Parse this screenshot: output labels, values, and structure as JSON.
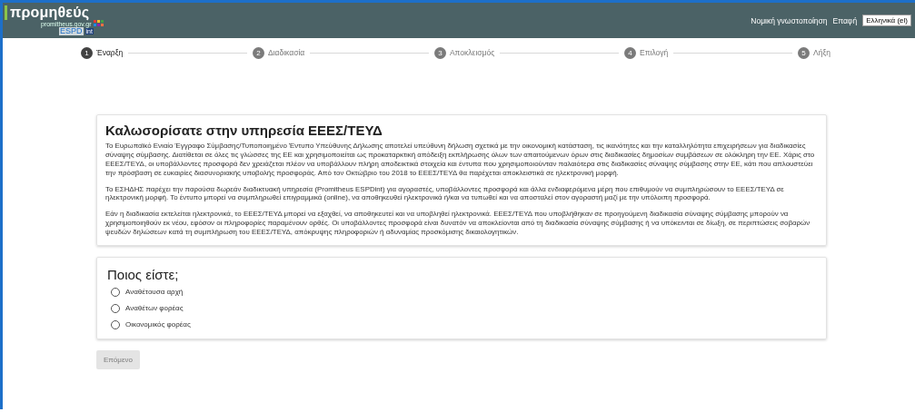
{
  "header": {
    "logo": {
      "name": "προμηθεύς",
      "domain": "promitheus.gov.gr",
      "product": "ESPD",
      "badge": "int"
    },
    "links": [
      {
        "label": "Νομική γνωστοποίηση"
      },
      {
        "label": "Επαφή"
      }
    ],
    "language": {
      "value": "Ελληνικά (el)"
    }
  },
  "steps": [
    {
      "number": "1",
      "label": "Έναρξη",
      "selected": true
    },
    {
      "number": "2",
      "label": "Διαδικασία",
      "selected": false
    },
    {
      "number": "3",
      "label": "Αποκλεισμός",
      "selected": false
    },
    {
      "number": "4",
      "label": "Επιλογή",
      "selected": false
    },
    {
      "number": "5",
      "label": "Λήξη",
      "selected": false
    }
  ],
  "welcome": {
    "title": "Καλωσορίσατε στην υπηρεσία ΕΕΕΣ/ΤΕΥΔ",
    "paragraphs": [
      "Το Ευρωπαϊκό Ενιαίο Έγγραφο Σύμβασης/Τυποποιημένο Έντυπο Υπεύθυνης Δήλωσης αποτελεί υπεύθυνη δήλωση σχετικά με την οικονομική κατάσταση, τις ικανότητες και την καταλληλότητα επιχειρήσεων για διαδικασίες σύναψης σύμβασης. Διατίθεται σε όλες τις γλώσσες της ΕΕ και χρησιμοποιείται ως προκαταρκτική απόδειξη εκπλήρωσης όλων των απαιτούμενων όρων στις διαδικασίες δημοσίων συμβάσεων σε ολόκληρη την ΕΕ. Χάρις στο ΕΕΕΣ/ΤΕΥΔ, οι υποβάλλοντες προσφορά δεν χρειάζεται πλέον να υποβάλλουν πλήρη αποδεικτικά στοιχεία και έντυπα που χρησιμοποιούνταν παλαιότερα στις διαδικασίες σύναψης σύμβασης στην ΕΕ, κάτι που απλουστεύει την πρόσβαση σε ευκαιρίες διασυνοριακής υποβολής προσφοράς. Από τον Οκτώβριο του 2018 το ΕΕΕΣ/ΤΕΥΔ θα παρέχεται αποκλειστικά σε ηλεκτρονική μορφή.",
      "Το ΕΣΗΔΗΣ παρέχει την παρούσα δωρεάν διαδικτυακή υπηρεσία (Promitheus ESPDint) για αγοραστές, υποβάλλοντες προσφορά και άλλα ενδιαφερόμενα μέρη που επιθυμούν να συμπληρώσουν το ΕΕΕΣ/ΤΕΥΔ σε ηλεκτρονική μορφή. Το έντυπο μπορεί να συμπληρωθεί επιγραμμικά (online), να αποθηκευθεί ηλεκτρονικά ή/και να τυπωθεί και να αποσταλεί στον αγοραστή μαζί με την υπόλοιπη προσφορά.",
      "Εάν η διαδικασία εκτελείται ηλεκτρονικά, το ΕΕΕΣ/ΤΕΥΔ μπορεί να εξαχθεί, να αποθηκευτεί και να υποβληθεί ηλεκτρονικά. ΕΕΕΣ/ΤΕΥΔ που υποβλήθηκαν σε προηγούμενη διαδικασία σύναψης σύμβασης  μπορούν να χρησιμοποιηθούν εκ νέου, εφόσον οι πληροφορίες παραμένουν ορθές. Οι υποβάλλοντες προσφορά είναι δυνατόν να αποκλείονται από τη διαδικασία σύναψης σύμβασης ή να υπόκεινται σε δίωξη, σε περιπτώσεις σοβαρών ψευδών δηλώσεων κατά τη συμπλήρωση του ΕΕΕΣ/ΤΕΥΔ, απόκρυψης πληροφοριών ή αδυναμίας προσκόμισης δικαιολογητικών."
    ]
  },
  "role": {
    "title": "Ποιος είστε;",
    "options": [
      {
        "label": "Αναθέτουσα αρχή",
        "selected": false
      },
      {
        "label": "Αναθέτων φορέας",
        "selected": false
      },
      {
        "label": "Οικονομικός φορέας",
        "selected": false
      }
    ]
  },
  "next_button": {
    "label": "Επόμενο",
    "disabled": true
  }
}
